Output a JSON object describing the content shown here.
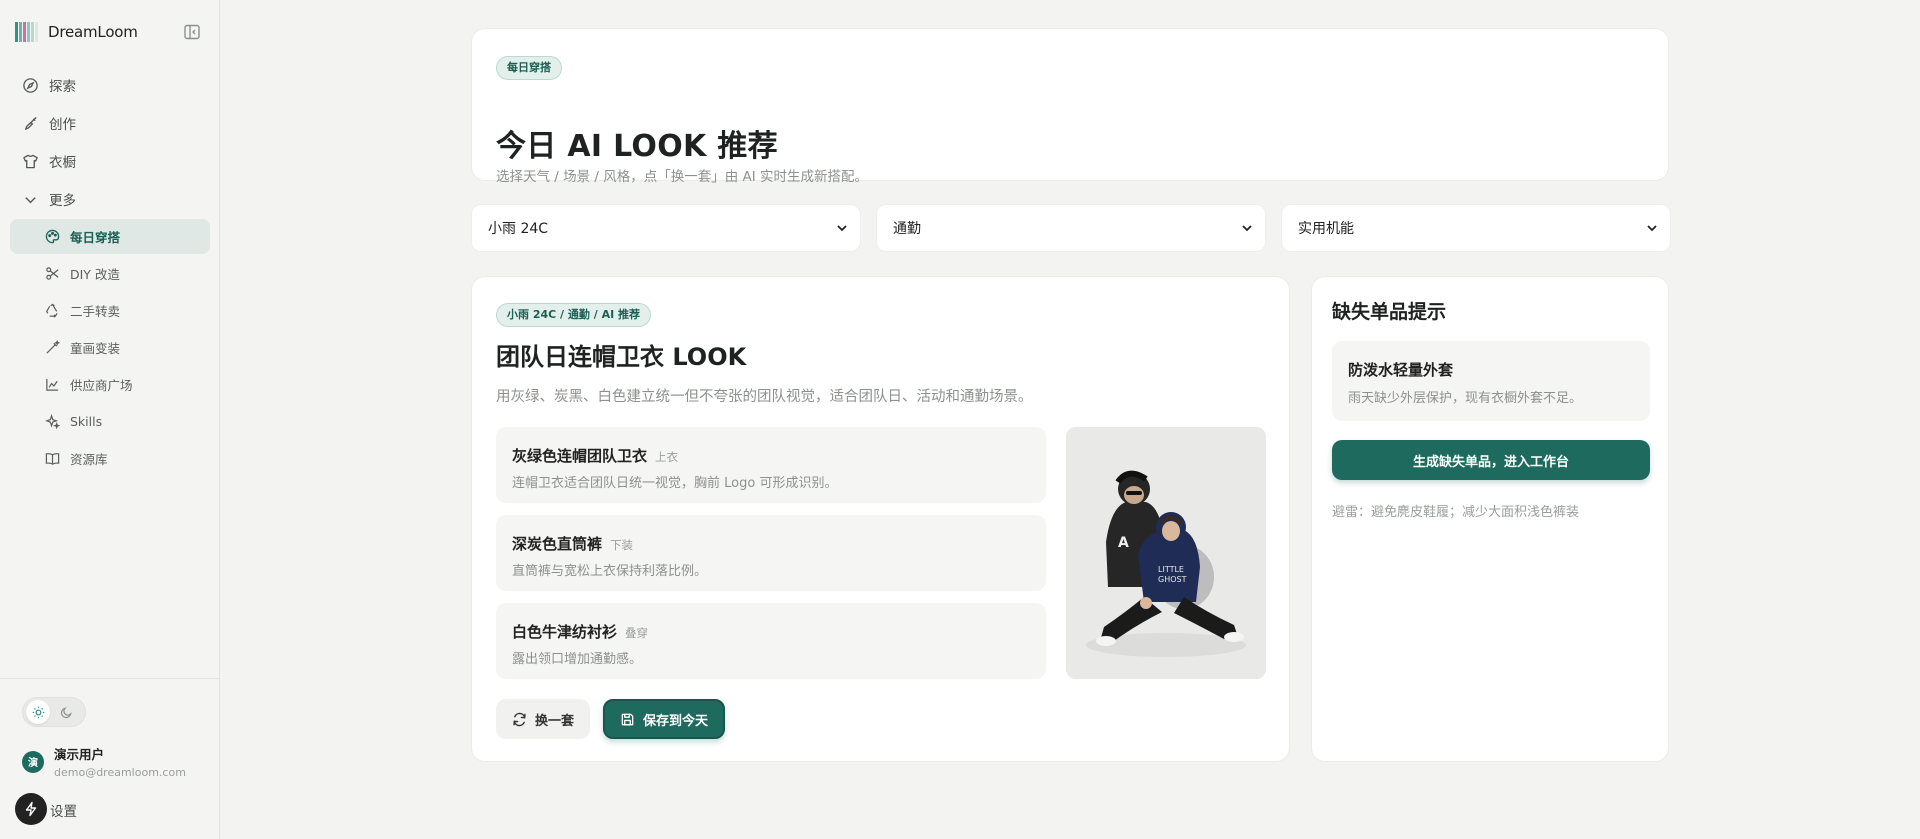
{
  "brand": {
    "name": "DreamLoom"
  },
  "nav": {
    "items": [
      {
        "label": "探索",
        "icon": "compass-icon"
      },
      {
        "label": "创作",
        "icon": "brush-icon"
      },
      {
        "label": "衣橱",
        "icon": "shirt-icon"
      }
    ],
    "more_label": "更多",
    "sub_items": [
      {
        "label": "每日穿搭",
        "icon": "palette-icon",
        "active": true
      },
      {
        "label": "DIY 改造",
        "icon": "scissors-icon"
      },
      {
        "label": "二手转卖",
        "icon": "recycle-icon"
      },
      {
        "label": "童画变装",
        "icon": "magic-wand-icon"
      },
      {
        "label": "供应商广场",
        "icon": "chart-icon"
      },
      {
        "label": "Skills",
        "icon": "sparkle-icon"
      },
      {
        "label": "资源库",
        "icon": "book-icon"
      }
    ]
  },
  "user": {
    "name": "演示用户",
    "email": "demo@dreamloom.com",
    "avatar_letter": "演"
  },
  "settings_label": "设置",
  "hero": {
    "badge": "每日穿搭",
    "title": "今日 AI LOOK 推荐",
    "subtitle": "选择天气 / 场景 / 风格，点「换一套」由 AI 实时生成新搭配。"
  },
  "filters": {
    "weather": "小雨 24C",
    "scene": "通勤",
    "style": "实用机能"
  },
  "look": {
    "badge": "小雨 24C / 通勤 / AI 推荐",
    "title": "团队日连帽卫衣 LOOK",
    "description": "用灰绿、炭黑、白色建立统一但不夸张的团队视觉，适合团队日、活动和通勤场景。",
    "items": [
      {
        "name": "灰绿色连帽团队卫衣",
        "tag": "上衣",
        "desc": "连帽卫衣适合团队日统一视觉，胸前 Logo 可形成识别。"
      },
      {
        "name": "深炭色直筒裤",
        "tag": "下装",
        "desc": "直筒裤与宽松上衣保持利落比例。"
      },
      {
        "name": "白色牛津纺衬衫",
        "tag": "叠穿",
        "desc": "露出领口增加通勤感。"
      }
    ],
    "swap_label": "换一套",
    "save_label": "保存到今天"
  },
  "missing": {
    "title": "缺失单品提示",
    "item_name": "防泼水轻量外套",
    "item_desc": "雨天缺少外层保护，现有衣橱外套不足。",
    "generate_label": "生成缺失单品，进入工作台",
    "avoid_text": "避雷：避免麂皮鞋履；减少大面积浅色裤装"
  },
  "colors": {
    "accent": "#1e6a5e",
    "accent_light": "#e3efeb",
    "background": "#f3f3f1"
  }
}
